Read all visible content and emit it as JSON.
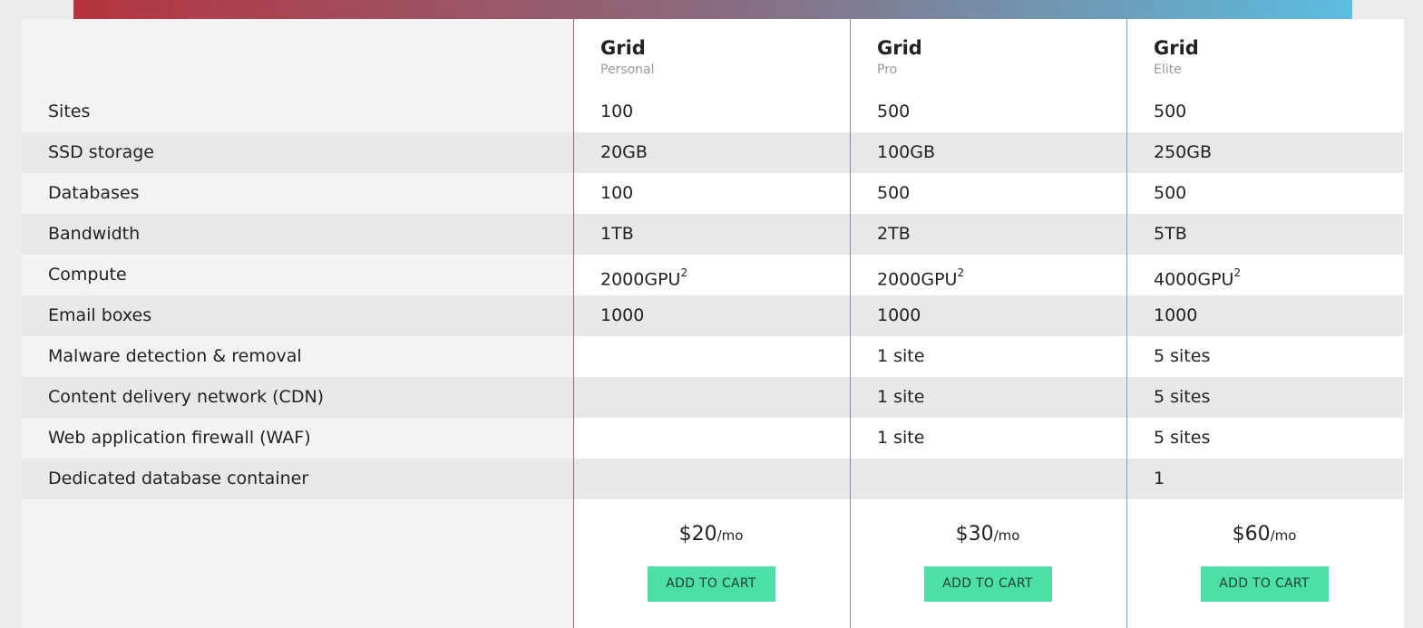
{
  "plans": [
    {
      "name": "Grid",
      "tier": "Personal",
      "price": "$20",
      "period": "/mo",
      "button": "ADD TO CART"
    },
    {
      "name": "Grid",
      "tier": "Pro",
      "price": "$30",
      "period": "/mo",
      "button": "ADD TO CART"
    },
    {
      "name": "Grid",
      "tier": "Elite",
      "price": "$60",
      "period": "/mo",
      "button": "ADD TO CART"
    }
  ],
  "features": [
    {
      "label": "Sites",
      "values": [
        "100",
        "500",
        "500"
      ]
    },
    {
      "label": "SSD storage",
      "values": [
        "20GB",
        "100GB",
        "250GB"
      ]
    },
    {
      "label": "Databases",
      "values": [
        "100",
        "500",
        "500"
      ]
    },
    {
      "label": "Bandwidth",
      "values": [
        "1TB",
        "2TB",
        "5TB"
      ]
    },
    {
      "label": "Compute",
      "values": [
        "2000GPU",
        "2000GPU",
        "4000GPU"
      ],
      "footnote": "2"
    },
    {
      "label": "Email boxes",
      "values": [
        "1000",
        "1000",
        "1000"
      ]
    },
    {
      "label": "Malware detection & removal",
      "values": [
        "",
        "1 site",
        "5 sites"
      ]
    },
    {
      "label": "Content delivery network (CDN)",
      "values": [
        "",
        "1 site",
        "5 sites"
      ]
    },
    {
      "label": "Web application firewall (WAF)",
      "values": [
        "",
        "1 site",
        "5 sites"
      ]
    },
    {
      "label": "Dedicated database container",
      "values": [
        "",
        "",
        "1"
      ]
    }
  ],
  "colors": {
    "accent_button": "#4ce0a6",
    "gradient_start": "#b5343e",
    "gradient_end": "#5bbde0",
    "shaded_row": "#e8e8e8"
  }
}
